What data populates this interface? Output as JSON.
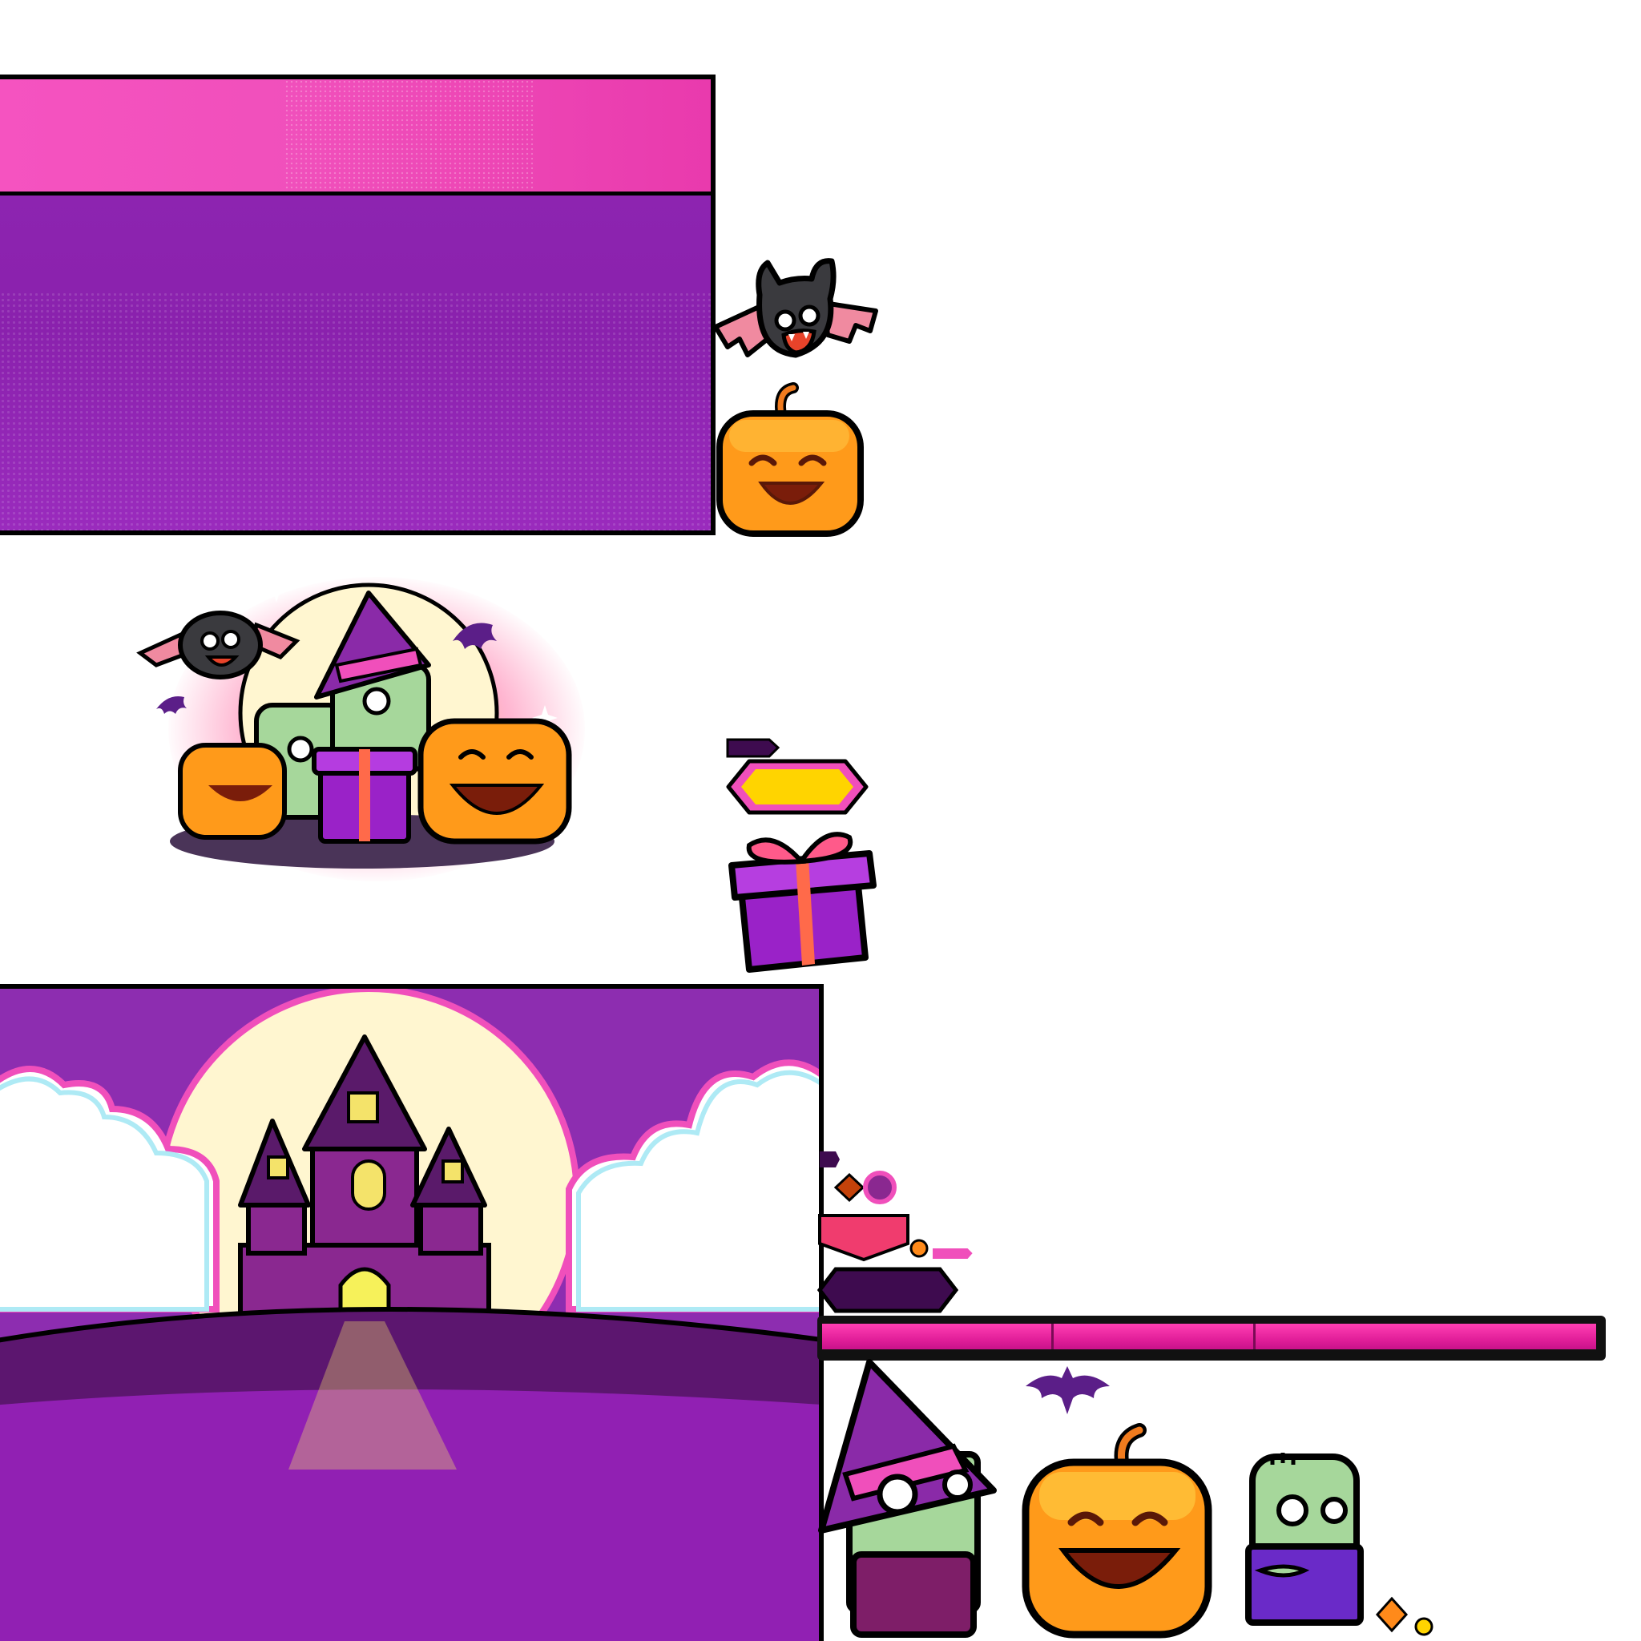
{
  "sprite_sheet": {
    "theme": "halloween",
    "colors": {
      "pink": "#f04fbb",
      "purple": "#8e24b2",
      "dark_purple": "#3e0b4f",
      "orange": "#ff9a1a",
      "yellow": "#ffd400",
      "outline": "#000000",
      "zombie_green": "#a6d79b",
      "moon": "#fff6d0"
    },
    "assets": [
      {
        "name": "panel-pink-purple",
        "icon": "panel"
      },
      {
        "name": "bat",
        "icon": "bat-icon"
      },
      {
        "name": "pumpkin-small",
        "icon": "pumpkin-icon"
      },
      {
        "name": "halloween-group-glow",
        "icon": "group-illustration"
      },
      {
        "name": "label-yellow-hex",
        "icon": "hex-label"
      },
      {
        "name": "gift-box",
        "icon": "gift-icon"
      },
      {
        "name": "castle-scene",
        "icon": "castle-icon"
      },
      {
        "name": "pink-progress-bar",
        "icon": "progress-bar"
      },
      {
        "name": "witch-zombie",
        "icon": "witch-icon"
      },
      {
        "name": "pumpkin-laughing",
        "icon": "pumpkin-icon"
      },
      {
        "name": "zombie",
        "icon": "zombie-icon"
      },
      {
        "name": "bat-silhouette",
        "icon": "bat-icon"
      }
    ]
  }
}
